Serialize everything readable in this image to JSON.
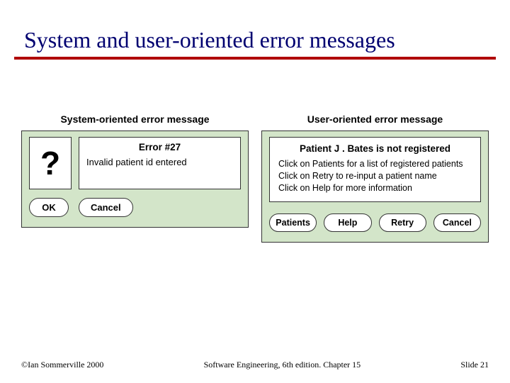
{
  "title": "System and user-oriented error messages",
  "panels": {
    "system": {
      "label": "System-oriented error message",
      "icon_glyph": "?",
      "error_title": "Error #27",
      "error_body": "Invalid patient id entered",
      "buttons": [
        "OK",
        "Cancel"
      ]
    },
    "user": {
      "label": "User-oriented error message",
      "error_title": "Patient J  . Bates is not registered",
      "lines": [
        "Click on Patients for a list of registered patients",
        "Click on Retry to re-input a patient name",
        "Click on Help for more information"
      ],
      "buttons": [
        "Patients",
        "Help",
        "Retry",
        "Cancel"
      ]
    }
  },
  "footer": {
    "left": "©Ian Sommerville 2000",
    "center": "Software Engineering, 6th edition. Chapter 15",
    "right": "Slide 21"
  }
}
